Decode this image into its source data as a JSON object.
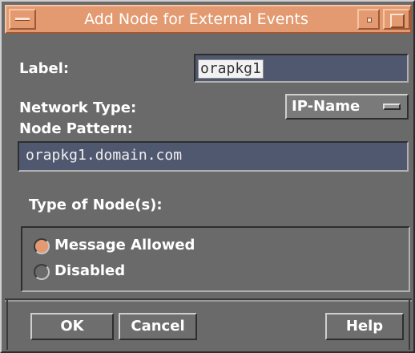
{
  "dialog": {
    "title": "Add Node for External Events"
  },
  "label_field": {
    "label": "Label:",
    "value": "orapkg1"
  },
  "network_type": {
    "label": "Network Type:",
    "value": "IP-Name"
  },
  "node_pattern": {
    "label": "Node Pattern:",
    "value": "orapkg1.domain.com"
  },
  "node_type": {
    "label": "Type of Node(s):",
    "options": [
      {
        "label": "Message Allowed",
        "selected": true
      },
      {
        "label": "Disabled",
        "selected": false
      }
    ]
  },
  "buttons": {
    "ok": "OK",
    "cancel": "Cancel",
    "help": "Help"
  },
  "colors": {
    "title_bar": "#e39a70",
    "dialog_background": "#6a6a6a",
    "text_field_background": "#505870",
    "selected_radio": "#e39a70"
  },
  "icons": {
    "window_menu": "window-menu-icon",
    "minimize": "minimize-icon",
    "maximize": "maximize-icon",
    "option_menu": "option-menu-indicator-icon"
  }
}
